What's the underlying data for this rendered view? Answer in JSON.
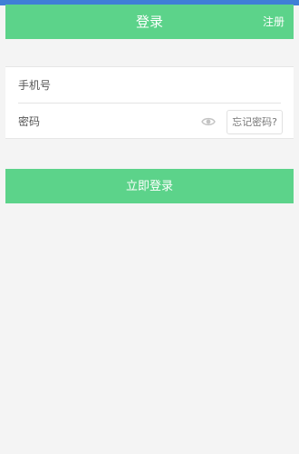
{
  "header": {
    "title": "登录",
    "register_label": "注册"
  },
  "form": {
    "phone_placeholder": "手机号",
    "password_placeholder": "密码",
    "forgot_label": "忘记密码?"
  },
  "login_button_label": "立即登录",
  "colors": {
    "accent": "#5cd38a",
    "status_bar": "#3f7fd6",
    "background": "#f4f4f4"
  },
  "icons": {
    "password_visibility": "eye-icon"
  }
}
